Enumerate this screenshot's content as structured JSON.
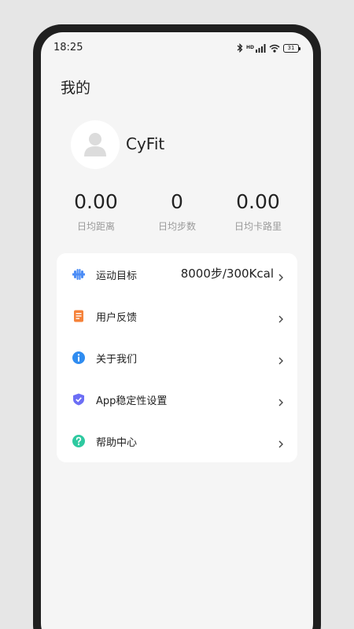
{
  "status_bar": {
    "time": "18:25",
    "network_label": "HD",
    "battery": "31",
    "icons": [
      "bluetooth-icon",
      "signal-icon",
      "wifi-icon",
      "battery-icon"
    ]
  },
  "header": {
    "title": "我的"
  },
  "profile": {
    "name": "CyFit",
    "avatar_icon": "user-placeholder-icon"
  },
  "stats": [
    {
      "value": "0.00",
      "label": "日均距离"
    },
    {
      "value": "0",
      "label": "日均步数"
    },
    {
      "value": "0.00",
      "label": "日均卡路里"
    }
  ],
  "menu": [
    {
      "label": "运动目标",
      "value": "8000步/300Kcal",
      "icon": "dumbbell-icon",
      "color": "#4c8df6"
    },
    {
      "label": "用户反馈",
      "value": "",
      "icon": "document-icon",
      "color": "#f5823a"
    },
    {
      "label": "关于我们",
      "value": "",
      "icon": "info-icon",
      "color": "#2f8cf0"
    },
    {
      "label": "App稳定性设置",
      "value": "",
      "icon": "shield-icon",
      "color": "#6c6ef5"
    },
    {
      "label": "帮助中心",
      "value": "",
      "icon": "help-icon",
      "color": "#2ec9a0"
    }
  ]
}
